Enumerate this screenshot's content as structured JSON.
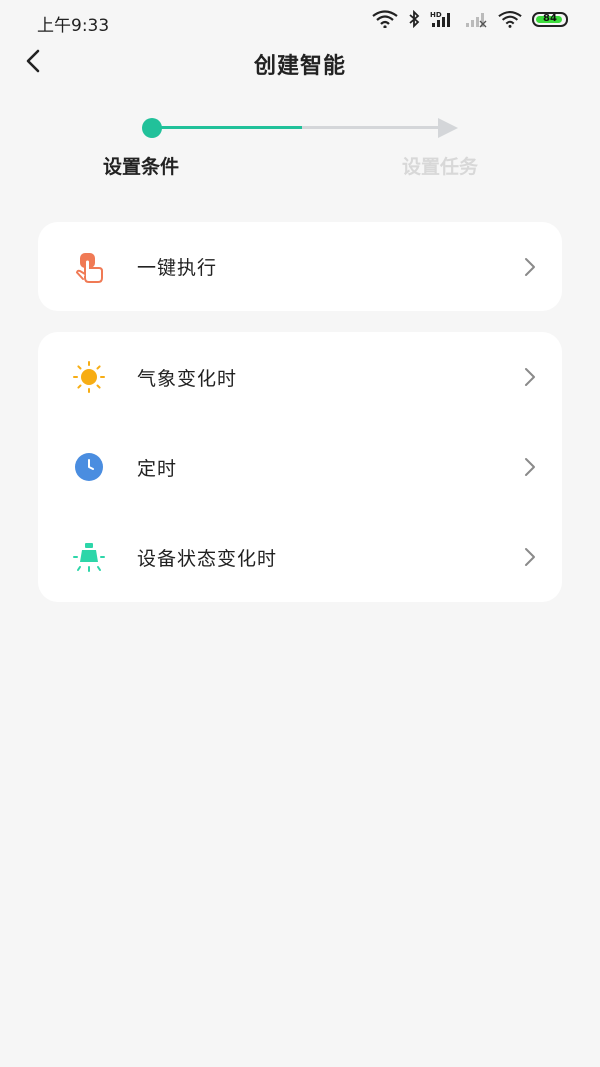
{
  "status_bar": {
    "time": "上午9:33",
    "battery": "84",
    "icons": [
      "wifi-icon",
      "bluetooth-icon",
      "signal-hd-icon",
      "signal-no-service-icon",
      "wifi-icon",
      "battery-icon"
    ]
  },
  "header": {
    "title": "创建智能",
    "back_icon": "chevron-left-icon"
  },
  "stepper": {
    "steps": [
      {
        "label": "设置条件",
        "state": "active"
      },
      {
        "label": "设置任务",
        "state": "inactive"
      }
    ],
    "accent_color": "#21c19a",
    "inactive_color": "#d4d6d9"
  },
  "sections": {
    "manual": {
      "items": [
        {
          "label": "一键执行",
          "icon": "tap-hand-icon",
          "icon_color": "#f07a55"
        }
      ]
    },
    "conditions": {
      "items": [
        {
          "label": "气象变化时",
          "icon": "sun-icon",
          "icon_color": "#f7ad14"
        },
        {
          "label": "定时",
          "icon": "clock-icon",
          "icon_color": "#4a8de0"
        },
        {
          "label": "设备状态变化时",
          "icon": "device-light-icon",
          "icon_color": "#2dd6a9"
        }
      ]
    }
  }
}
